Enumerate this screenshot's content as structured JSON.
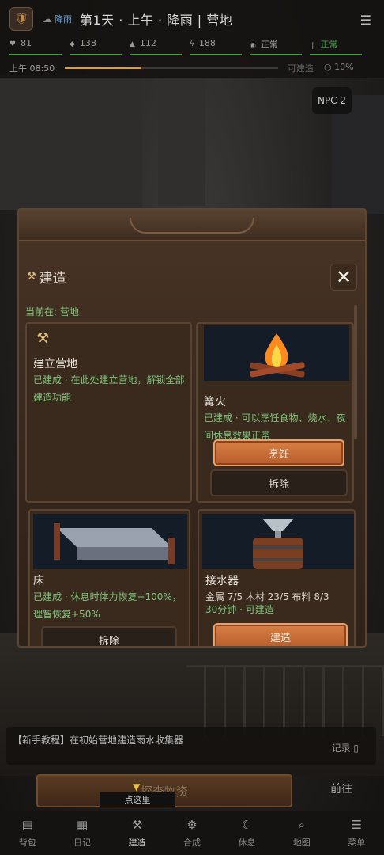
{
  "header": {
    "weather_label": "降雨",
    "title": "第1天 · 上午 · 降雨 | 营地"
  },
  "stats": [
    {
      "icon": "heart-icon",
      "value": "81",
      "color": "#4a9a4a"
    },
    {
      "icon": "food-icon",
      "value": "138",
      "color": "#4a9a4a"
    },
    {
      "icon": "water-icon",
      "value": "112",
      "color": "#4a9a4a"
    },
    {
      "icon": "energy-icon",
      "value": "188",
      "color": "#4a9a4a"
    },
    {
      "icon": "mind-icon",
      "value": "正常",
      "color": "#4a9a4a"
    },
    {
      "icon": "status-icon",
      "value": "正常",
      "color": "#4a9a4a"
    }
  ],
  "time": {
    "clock": "上午 08:50",
    "progress": 0.36,
    "status": "可建造",
    "percent": "10%"
  },
  "npc": "NPC 2",
  "modal": {
    "title": "建造",
    "current": "当前在: 营地",
    "cards": [
      {
        "name": "建立营地",
        "desc": "已建成 · 在此处建立营地，解锁全部建造功能"
      },
      {
        "name": "篝火",
        "desc": "已建成 · 可以烹饪食物、烧水、夜间休息效果正常",
        "btn1": "烹饪",
        "btn2": "拆除"
      },
      {
        "name": "床",
        "desc": "已建成 · 休息时体力恢复+100%，理智恢复+50%",
        "btn1": "拆除"
      },
      {
        "name": "接水器",
        "res": "金属 7/5  木材 23/5  布料 8/3",
        "desc": "30分钟 · 可建造",
        "btn1": "建造"
      }
    ]
  },
  "quest": {
    "text": "【新手教程】在初始营地建造雨水收集器",
    "log": "记录 ▯"
  },
  "explore_label": "探查物资",
  "hint": "点这里",
  "go": "前往",
  "nav": [
    {
      "icon": "backpack-icon",
      "label": "背包"
    },
    {
      "icon": "journal-icon",
      "label": "日记"
    },
    {
      "icon": "build-icon",
      "label": "建造"
    },
    {
      "icon": "craft-icon",
      "label": "合成"
    },
    {
      "icon": "rest-icon",
      "label": "休息"
    },
    {
      "icon": "map-icon",
      "label": "地图"
    },
    {
      "icon": "menu-icon",
      "label": "菜单"
    }
  ]
}
